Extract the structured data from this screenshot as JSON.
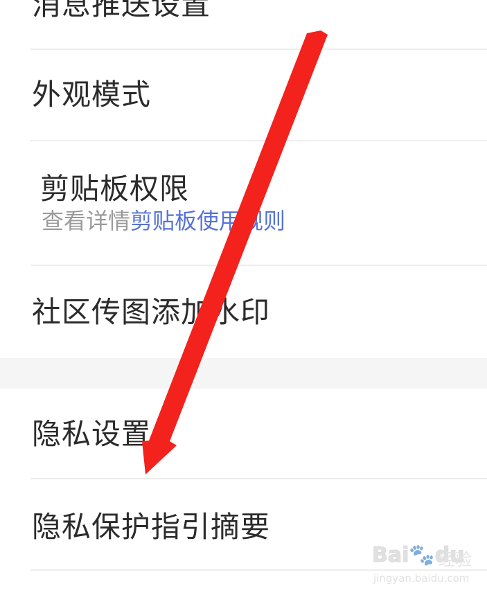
{
  "settings": {
    "items": [
      {
        "label": "消息推送设置"
      },
      {
        "label": "外观模式"
      },
      {
        "label": "剪贴板权限",
        "subtitle_prefix": "查看详情",
        "subtitle_link": "剪贴板使用规则"
      },
      {
        "label": "社区传图添加水印"
      },
      {
        "label": "隐私设置"
      },
      {
        "label": "隐私保护指引摘要"
      }
    ]
  },
  "watermark": {
    "logo": "Bai",
    "paw": "du",
    "jingyan": "经验",
    "url": "jingyan.baidu.com"
  },
  "annotation": {
    "arrow_color": "#f3221c"
  },
  "colors": {
    "text": "#2b2b2b",
    "subtitle_gray": "#9a9a9a",
    "link_blue": "#5573d6",
    "divider": "#ededed",
    "section_gap": "#f5f5f5"
  }
}
